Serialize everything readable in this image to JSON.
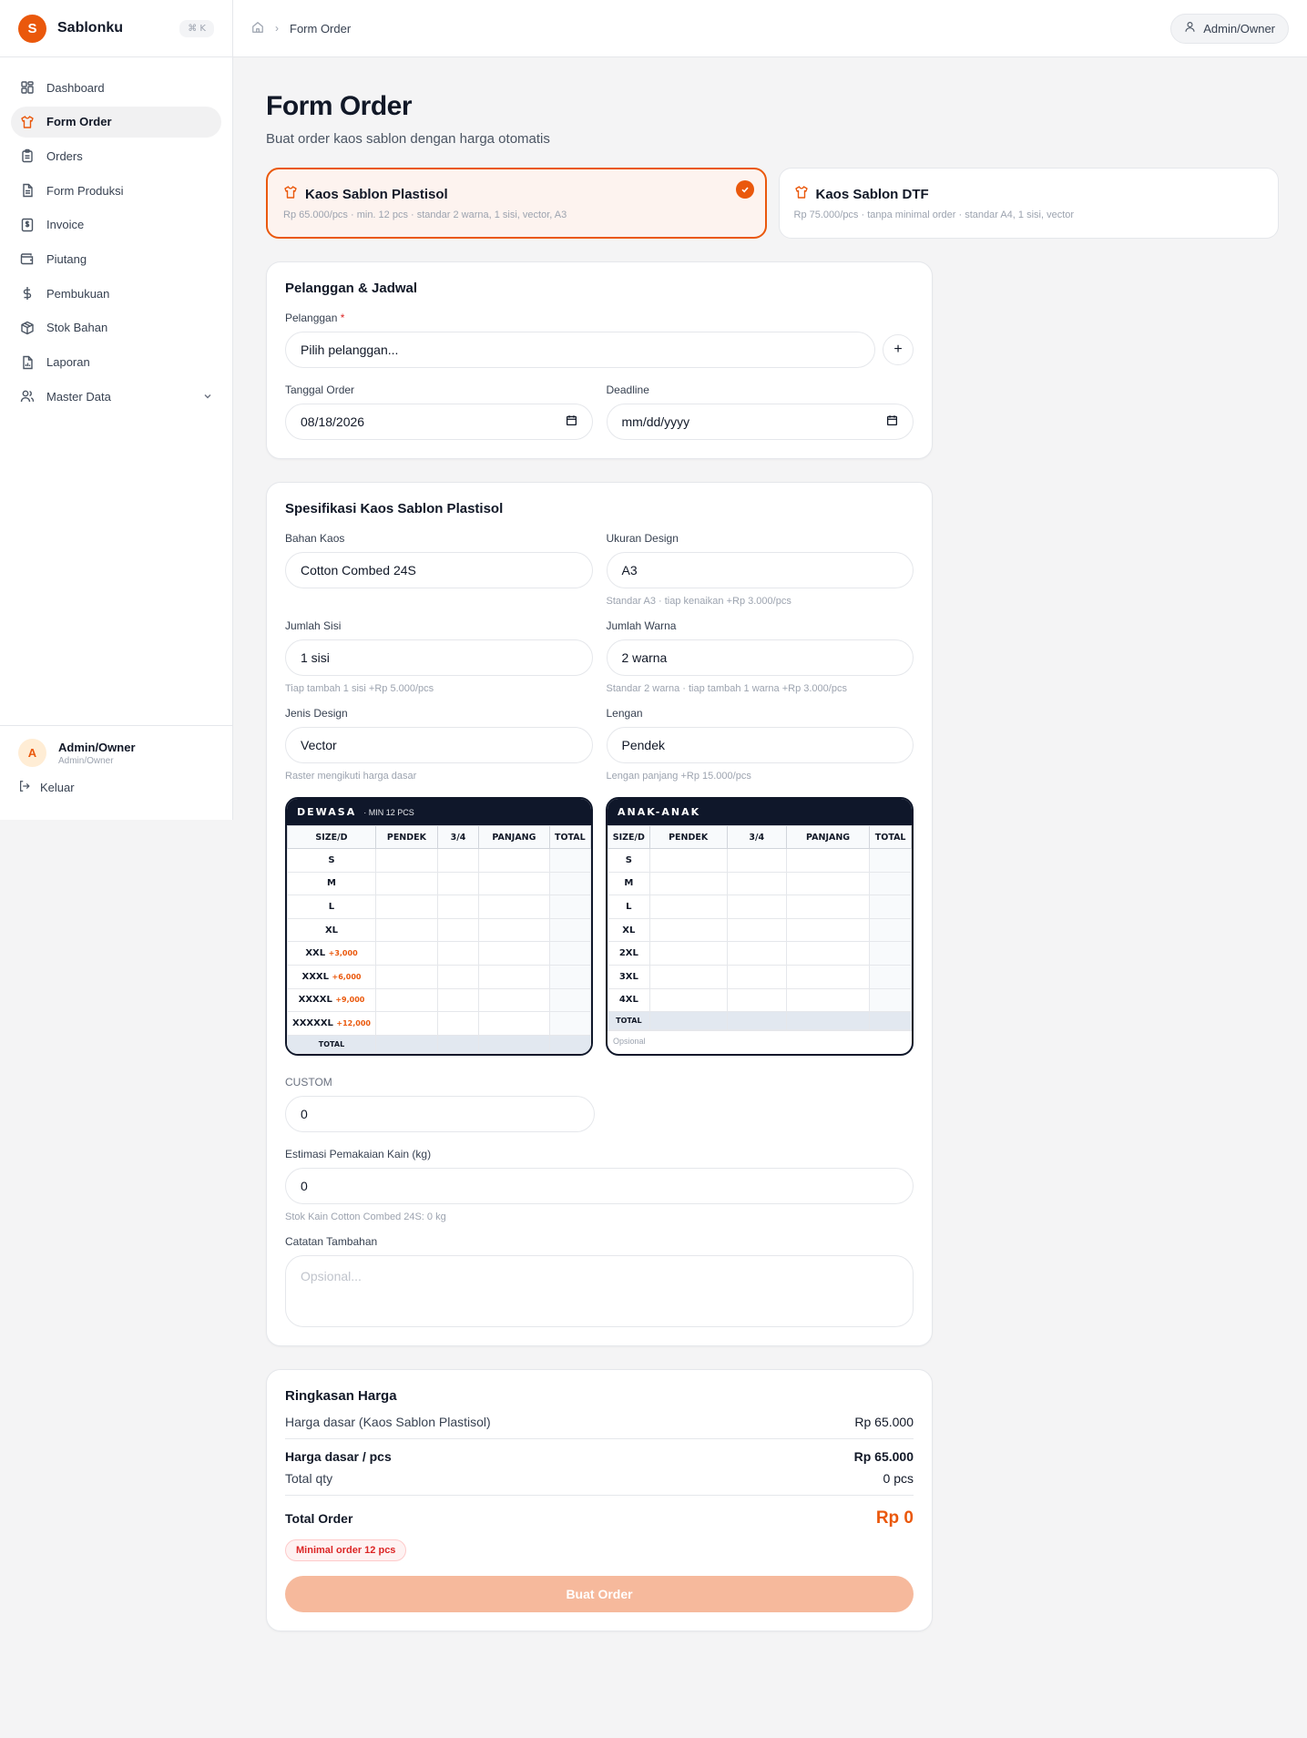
{
  "app": {
    "logo_letter": "S",
    "name": "Sablonku",
    "shortcut": "⌘ K"
  },
  "sidebar": {
    "items": [
      {
        "label": "Dashboard",
        "icon": "grid-icon"
      },
      {
        "label": "Form Order",
        "icon": "shirt-icon",
        "active": true
      },
      {
        "label": "Orders",
        "icon": "clipboard-icon"
      },
      {
        "label": "Form Produksi",
        "icon": "file-icon"
      },
      {
        "label": "Invoice",
        "icon": "invoice-icon"
      },
      {
        "label": "Piutang",
        "icon": "wallet-icon"
      },
      {
        "label": "Pembukuan",
        "icon": "dollar-icon"
      },
      {
        "label": "Stok Bahan",
        "icon": "box-icon"
      },
      {
        "label": "Laporan",
        "icon": "report-icon"
      },
      {
        "label": "Master Data",
        "icon": "users-icon"
      }
    ],
    "user": {
      "initial": "A",
      "name": "Admin/Owner",
      "role": "Admin/Owner"
    },
    "logout_label": "Keluar"
  },
  "topbar": {
    "breadcrumb": "Form Order",
    "user_label": "Admin/Owner"
  },
  "page": {
    "title": "Form Order",
    "subtitle": "Buat order kaos sablon dengan harga otomatis"
  },
  "types": [
    {
      "title": "Kaos Sablon Plastisol",
      "desc": "Rp 65.000/pcs · min. 12 pcs · standar 2 warna, 1 sisi, vector, A3",
      "selected": true
    },
    {
      "title": "Kaos Sablon DTF",
      "desc": "Rp 75.000/pcs · tanpa minimal order · standar A4, 1 sisi, vector",
      "selected": false
    }
  ],
  "customer": {
    "title": "Pelanggan & Jadwal",
    "customer_label": "Pelanggan",
    "required_mark": "*",
    "customer_value": "Pilih pelanggan...",
    "add_label": "+",
    "order_date_label": "Tanggal Order",
    "order_date_value": "08/18/2026",
    "deadline_label": "Deadline",
    "deadline_value": "mm/dd/yyyy"
  },
  "spec": {
    "title": "Spesifikasi Kaos Sablon Plastisol",
    "bahan_label": "Bahan Kaos",
    "bahan_value": "Cotton Combed 24S",
    "ukuran_label": "Ukuran Design",
    "ukuran_value": "A3",
    "ukuran_hint": "Standar A3 · tiap kenaikan +Rp 3.000/pcs",
    "sisi_label": "Jumlah Sisi",
    "sisi_value": "1 sisi",
    "sisi_hint": "Tiap tambah 1 sisi +Rp 5.000/pcs",
    "warna_label": "Jumlah Warna",
    "warna_value": "2 warna",
    "warna_hint": "Standar 2 warna · tiap tambah 1 warna +Rp 3.000/pcs",
    "jenis_label": "Jenis Design",
    "jenis_value": "Vector",
    "jenis_hint": "Raster mengikuti harga dasar",
    "lengan_label": "Lengan",
    "lengan_value": "Pendek",
    "lengan_hint": "Lengan panjang +Rp 15.000/pcs"
  },
  "dewasa": {
    "title": "DEWASA",
    "min": "· MIN 12 PCS",
    "headers": [
      "SIZE/D",
      "PENDEK",
      "3/4",
      "PANJANG",
      "TOTAL"
    ],
    "rows": [
      {
        "size": "S",
        "add": ""
      },
      {
        "size": "M",
        "add": ""
      },
      {
        "size": "L",
        "add": ""
      },
      {
        "size": "XL",
        "add": ""
      },
      {
        "size": "XXL",
        "add": "+3,000"
      },
      {
        "size": "XXXL",
        "add": "+6,000"
      },
      {
        "size": "XXXXL",
        "add": "+9,000"
      },
      {
        "size": "XXXXXL",
        "add": "+12,000"
      }
    ],
    "total_label": "TOTAL"
  },
  "anak": {
    "title": "ANAK-ANAK",
    "headers": [
      "SIZE/D",
      "PENDEK",
      "3/4",
      "PANJANG",
      "TOTAL"
    ],
    "rows": [
      "S",
      "M",
      "L",
      "XL",
      "2XL",
      "3XL",
      "4XL"
    ],
    "total_label": "TOTAL",
    "optional": "Opsional"
  },
  "extra": {
    "custom_label": "CUSTOM",
    "custom_value": "0",
    "kain_label": "Estimasi Pemakaian Kain (kg)",
    "kain_value": "0",
    "kain_hint": "Stok Kain Cotton Combed 24S: 0 kg",
    "notes_label": "Catatan Tambahan",
    "notes_placeholder": "Opsional..."
  },
  "summary": {
    "title": "Ringkasan Harga",
    "base_label": "Harga dasar (Kaos Sablon Plastisol)",
    "base_value": "Rp 65.000",
    "per_pcs_label": "Harga dasar / pcs",
    "per_pcs_value": "Rp 65.000",
    "qty_label": "Total qty",
    "qty_value": "0 pcs",
    "total_label": "Total Order",
    "total_value": "Rp 0",
    "warning": "Minimal order 12 pcs",
    "submit_label": "Buat Order"
  },
  "colors": {
    "accent": "#ea580c",
    "dark": "#0f172a"
  }
}
